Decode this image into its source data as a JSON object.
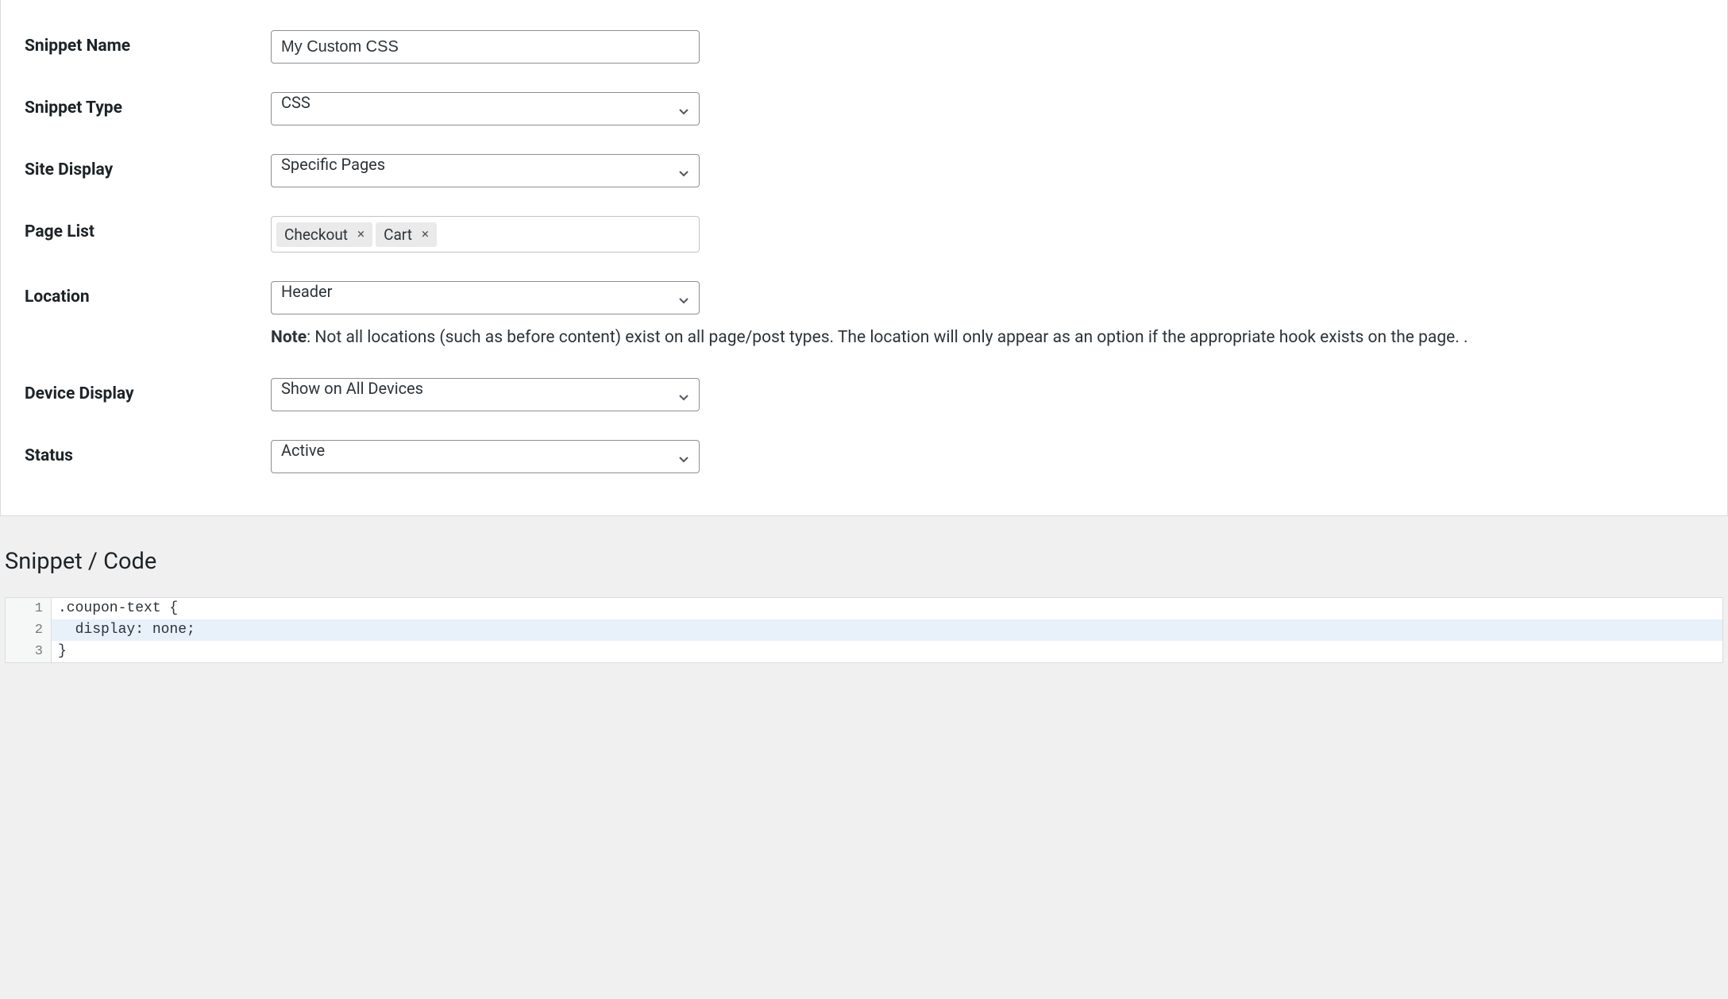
{
  "fields": {
    "snippet_name": {
      "label": "Snippet Name",
      "value": "My Custom CSS"
    },
    "snippet_type": {
      "label": "Snippet Type",
      "value": "CSS"
    },
    "site_display": {
      "label": "Site Display",
      "value": "Specific Pages"
    },
    "page_list": {
      "label": "Page List",
      "tags": [
        {
          "label": "Checkout"
        },
        {
          "label": "Cart"
        }
      ]
    },
    "location": {
      "label": "Location",
      "value": "Header",
      "note_label": "Note",
      "note_text": ": Not all locations (such as before content) exist on all page/post types. The location will only appear as an option if the appropriate hook exists on the page. ."
    },
    "device_display": {
      "label": "Device Display",
      "value": "Show on All Devices"
    },
    "status": {
      "label": "Status",
      "value": "Active"
    }
  },
  "code_section": {
    "heading": "Snippet / Code",
    "lines": [
      {
        "num": "1",
        "text": ".coupon-text {"
      },
      {
        "num": "2",
        "text": "  display: none;"
      },
      {
        "num": "3",
        "text": "}"
      }
    ]
  },
  "icons": {
    "remove": "×"
  }
}
